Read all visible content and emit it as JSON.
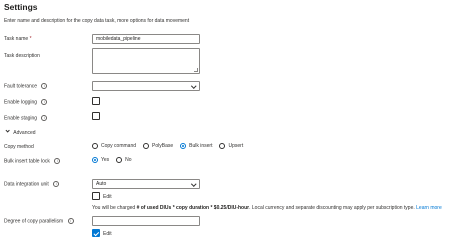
{
  "settings": {
    "title": "Settings",
    "description": "Enter name and description for the copy data task, more options for data movement",
    "task_name": {
      "label": "Task name",
      "required_marker": "*",
      "value": "mobiledata_pipeline"
    },
    "task_description": {
      "label": "Task description",
      "value": ""
    },
    "fault_tolerance": {
      "label": "Fault tolerance",
      "value": ""
    },
    "enable_logging": {
      "label": "Enable logging",
      "checked": false
    },
    "enable_staging": {
      "label": "Enable staging",
      "checked": false
    },
    "advanced": {
      "label": "Advanced",
      "expanded": true
    },
    "copy_method": {
      "label": "Copy method",
      "options": [
        "Copy command",
        "PolyBase",
        "Bulk insert",
        "Upsert"
      ],
      "selected": "Bulk insert"
    },
    "bulk_insert_table_lock": {
      "label": "Bulk insert table lock",
      "options": [
        "Yes",
        "No"
      ],
      "selected": "Yes"
    },
    "data_integration_unit": {
      "label": "Data integration unit",
      "value": "Auto",
      "edit_label": "Edit",
      "edit_checked": false
    },
    "charge_note": {
      "prefix": "You will be charged ",
      "bold1": "# of used DIUs * copy duration * $0.25/DIU-hour",
      "suffix": ". Local currency and separate discounting may apply per subscription type. ",
      "link": "Learn more"
    },
    "degree_of_copy_parallelism": {
      "label": "Degree of copy parallelism",
      "value": "",
      "edit_label": "Edit",
      "edit_checked": true
    }
  },
  "colors": {
    "accent": "#0078d4",
    "border": "#8a8886",
    "required": "#a4262c"
  },
  "icons": {
    "info": "info-icon",
    "chevron_down": "chevron-down-icon"
  }
}
